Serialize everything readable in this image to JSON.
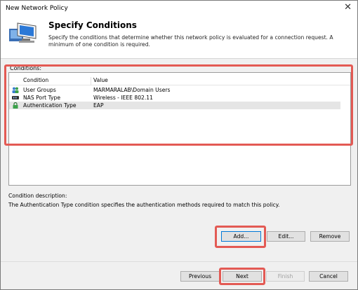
{
  "window": {
    "title": "New Network Policy",
    "close_glyph": "✕"
  },
  "header": {
    "title": "Specify Conditions",
    "description": "Specify the conditions that determine whether this network policy is evaluated for a connection request. A minimum of one condition is required.",
    "icon": "network-computer-icon"
  },
  "conditions": {
    "label": "Conditions:",
    "columns": [
      "Condition",
      "Value"
    ],
    "rows": [
      {
        "condition": "User Groups",
        "value": "MARMARALAB\\Domain Users",
        "icon": "user-groups-icon"
      },
      {
        "condition": "NAS Port Type",
        "value": "Wireless - IEEE 802.11",
        "icon": "nas-port-icon"
      },
      {
        "condition": "Authentication Type",
        "value": "EAP",
        "icon": "lock-icon",
        "selected": true
      }
    ]
  },
  "description": {
    "label": "Condition description:",
    "text": "The Authentication Type condition specifies the authentication methods required to match this policy."
  },
  "actions": {
    "add": "Add...",
    "edit": "Edit...",
    "remove": "Remove"
  },
  "nav": {
    "previous": "Previous",
    "next": "Next",
    "finish": "Finish",
    "cancel": "Cancel"
  },
  "colors": {
    "highlight": "#e35a54",
    "focus": "#0078d7"
  }
}
